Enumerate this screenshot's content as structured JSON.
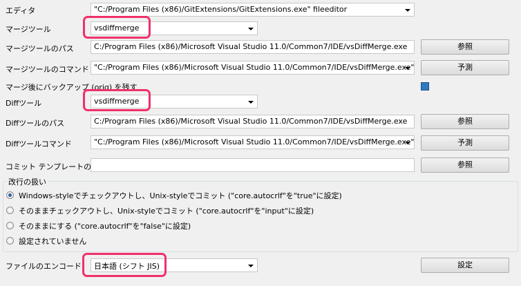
{
  "editor": {
    "label": "エディタ",
    "value": "\"C:/Program Files (x86)/GitExtensions/GitExtensions.exe\" fileeditor"
  },
  "merge_tool": {
    "label": "マージツール",
    "value": "vsdiffmerge"
  },
  "merge_tool_path": {
    "label": "マージツールのパス",
    "value": "C:/Program Files (x86)/Microsoft Visual Studio 11.0/Common7/IDE/vsDiffMerge.exe",
    "button": "参照"
  },
  "merge_tool_command": {
    "label": "マージツールのコマンド",
    "value": "\"C:/Program Files (x86)/Microsoft Visual Studio 11.0/Common7/IDE/vsDiffMerge.exe\"",
    "button": "予測"
  },
  "keep_backup": {
    "label": "マージ後にバックアップ (orig) を残す",
    "checked": true
  },
  "diff_tool": {
    "label": "Diffツール",
    "value": "vsdiffmerge"
  },
  "diff_tool_path": {
    "label": "Diffツールのパス",
    "value": "C:/Program Files (x86)/Microsoft Visual Studio 11.0/Common7/IDE/vsDiffMerge.exe",
    "button": "参照"
  },
  "diff_tool_command": {
    "label": "Diffツールコマンド",
    "value": "\"C:/Program Files (x86)/Microsoft Visual Studio 11.0/Common7/IDE/vsDiffMerge.exe\"",
    "button": "予測"
  },
  "commit_template": {
    "label": "コミット テンプレートのパス",
    "value": "",
    "button": "参照"
  },
  "line_endings": {
    "title": "改行の扱い",
    "options": [
      "Windows-styleでチェックアウトし、Unix-styleでコミット (\"core.autocrlf\"を\"true\"に設定)",
      "そのままチェックアウトし、Unix-styleでコミット (\"core.autocrlf\"を\"input\"に設定)",
      "そのままにする (\"core.autocrlf\"を\"false\"に設定)",
      "設定されていません"
    ],
    "selected": 0
  },
  "encoding": {
    "label": "ファイルのエンコード",
    "value": "日本語 (シフト JIS)",
    "button": "設定"
  },
  "highlight_color": "#f0306a"
}
